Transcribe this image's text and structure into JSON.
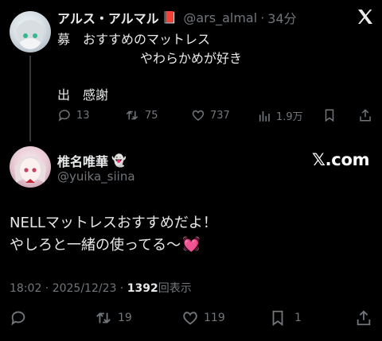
{
  "parent_tweet": {
    "display_name": "アルス・アルマル",
    "name_emoji": "📕",
    "handle": "@ars_almal",
    "separator": "·",
    "time_ago": "34分",
    "body_line1": "募　おすすめのマットレス",
    "body_line2": "やわらかめが好き",
    "body_line3": "出　感謝",
    "actions": {
      "replies": "13",
      "retweets": "75",
      "likes": "737",
      "views": "1.9万"
    }
  },
  "quoted_tweet": {
    "display_name": "椎名唯華",
    "name_emoji": "👻",
    "handle": "@yuika_siina",
    "brand": "𝕏.com",
    "body_line1": "NELLマットレスおすすめだよ！",
    "body_line2": "やしろと一緒の使ってる〜",
    "body_emoji": "💓",
    "timestamp": "18:02 · 2025/12/23 · ",
    "view_count": "1392",
    "view_label": "回表示",
    "actions": {
      "replies": "",
      "retweets": "19",
      "likes": "119",
      "bookmarks": "1"
    }
  },
  "brand_logo": "X",
  "colors": {
    "background": "#000000",
    "text": "#e7e9ea",
    "muted": "#71767b"
  }
}
